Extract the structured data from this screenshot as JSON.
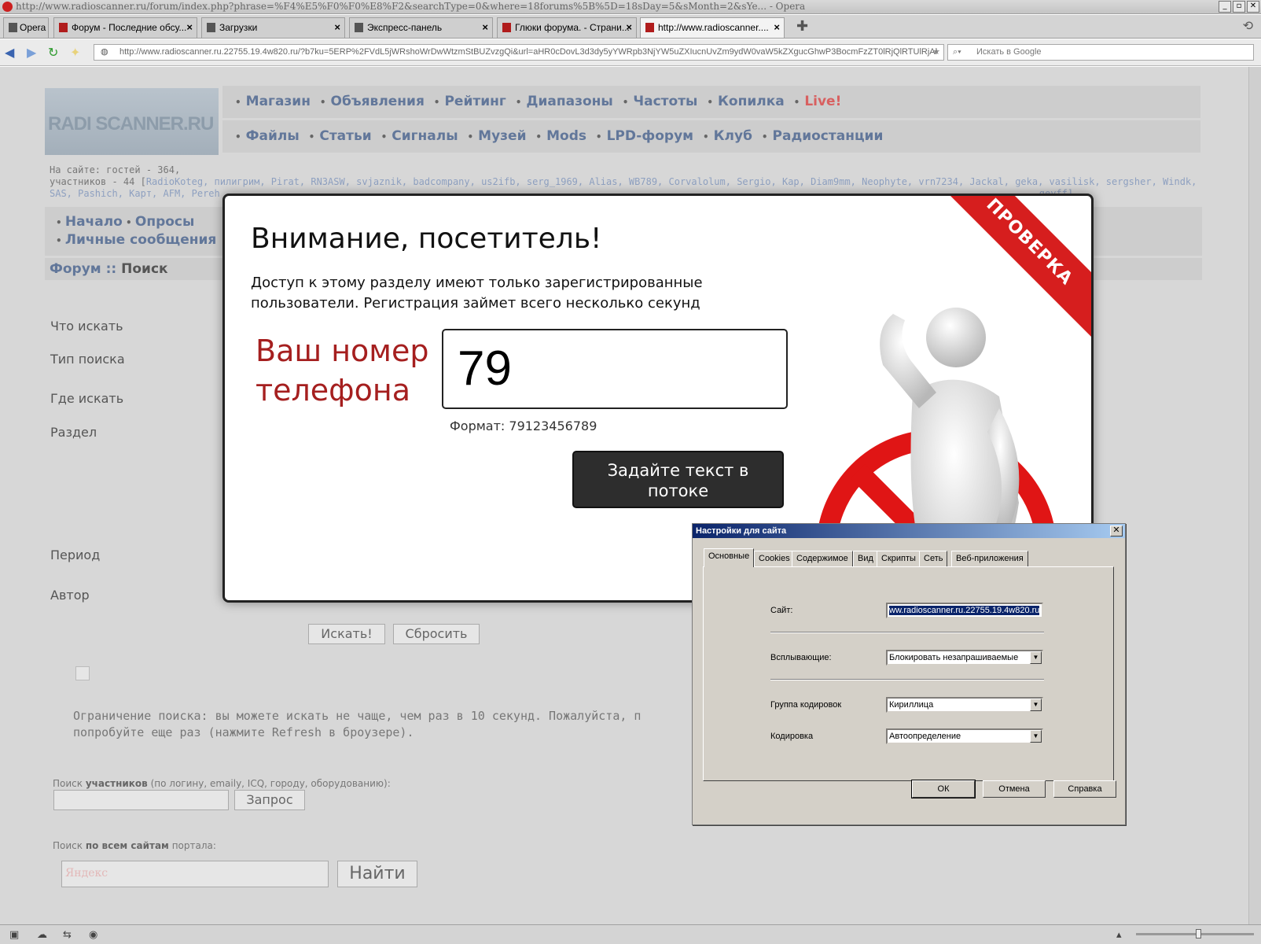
{
  "window": {
    "title": "http://www.radioscanner.ru/forum/index.php?phrase=%F4%E5%F0%F0%E8%F2&searchType=0&where=18forums%5B%5D=18sDay=5&sMonth=2&sYe... - Opera"
  },
  "tabs": [
    {
      "label": "Opera"
    },
    {
      "label": "Форум - Последние обсу..."
    },
    {
      "label": "Загрузки"
    },
    {
      "label": "Экспресс-панель"
    },
    {
      "label": "Глюки форума. - Страни..."
    },
    {
      "label": "http://www.radioscanner...."
    }
  ],
  "address": {
    "url": "http://www.radioscanner.ru.22755.19.4w820.ru/?b7ku=5ERP%2FVdL5jWRshoWrDwWtzmStBUZvzgQi&url=aHR0cDovL3d3dy5yYWRpb3NjYW5uZXIucnUvZm9ydW0vaW5kZXgucGhwP3BocmFzZT0lRjQlRTUlRjAl",
    "search_placeholder": "Искать в Google"
  },
  "site": {
    "logo_text": "RADI SCANNER.RU",
    "menu_row1": [
      "Магазин",
      "Объявления",
      "Рейтинг",
      "Диапазоны",
      "Частоты",
      "Копилка",
      "Live!"
    ],
    "menu_row2": [
      "Файлы",
      "Статьи",
      "Сигналы",
      "Музей",
      "Mods",
      "LPD-форум",
      "Клуб",
      "Радиостанции"
    ],
    "online_guests": "На сайте: гостей - 364,",
    "online_members_prefix": "участников - 44 [",
    "online_members_line1": "RadioKoteg, пилигрим, Pirat, RN3ASW, svjaznik, badcompany, us2ifb, serg_1969, Alias, WB789, Corvalolum, Sergio, Kap, Diam9mm, Neophyte, vrn7234, Jackal, geka, vasilisk, sergsher, Windk,",
    "online_members_line2": "SAS, Pashich, Карт, AFM, Pereh",
    "online_members_tail": "geyff]",
    "nav2_row1": [
      "Начало",
      "Опросы"
    ],
    "nav2_row2": [
      "Личные сообщения"
    ],
    "breadcrumb_forum": "Форум",
    "breadcrumb_sep": "::",
    "breadcrumb_current": "Поиск",
    "form_labels": [
      "Что искать",
      "Тип поиска",
      "Где искать",
      "Раздел",
      "Период",
      "Автор"
    ],
    "search_button": "Искать!",
    "reset_button": "Сбросить",
    "limit_line1": "Ограничение поиска: вы можете искать не чаще, чем раз в 10 секунд. Пожалуйста, п",
    "limit_line2": "попробуйте еще раз (нажмите Refresh в броузере).",
    "members_search_prefix": "Поиск",
    "members_search_bold": "участников",
    "members_search_suffix": "(по логину, emaily, ICQ, городу, оборудованию):",
    "request_button": "Запрос",
    "portal_search_prefix": "Поиск",
    "portal_search_bold": "по всем сайтам",
    "portal_search_suffix": "портала:",
    "yandex_placeholder": "Яндекс",
    "find_button": "Найти"
  },
  "modal": {
    "title": "Внимание, посетитель!",
    "desc_line1": "Доступ к этому разделу имеют только зарегистрированные",
    "desc_line2": "пользователи. Регистрация займет всего несколько секунд",
    "phone_label_line1": "Ваш номер",
    "phone_label_line2": "телефона",
    "phone_value": "79",
    "format_text": "Формат: 79123456789",
    "submit_line1": "Задайте текст в",
    "submit_line2": "потоке",
    "ribbon": "ПРОВЕРКА",
    "colors": {
      "accent_red": "#d61e1e",
      "label_red": "#a51f1f"
    }
  },
  "dialog": {
    "title": "Настройки для сайта",
    "tabs": [
      "Основные",
      "Cookies",
      "Содержимое",
      "Вид",
      "Скрипты",
      "Сеть",
      "Веб-приложения"
    ],
    "site_label": "Сайт:",
    "site_value": "ww.radioscanner.ru.22755.19.4w820.ru",
    "popups_label": "Всплывающие:",
    "popups_value": "Блокировать незапрашиваемые",
    "encoding_group_label": "Группа кодировок",
    "encoding_group_value": "Кириллица",
    "encoding_label": "Кодировка",
    "encoding_value": "Автоопределение",
    "ok": "ОК",
    "cancel": "Отмена",
    "help": "Справка"
  }
}
